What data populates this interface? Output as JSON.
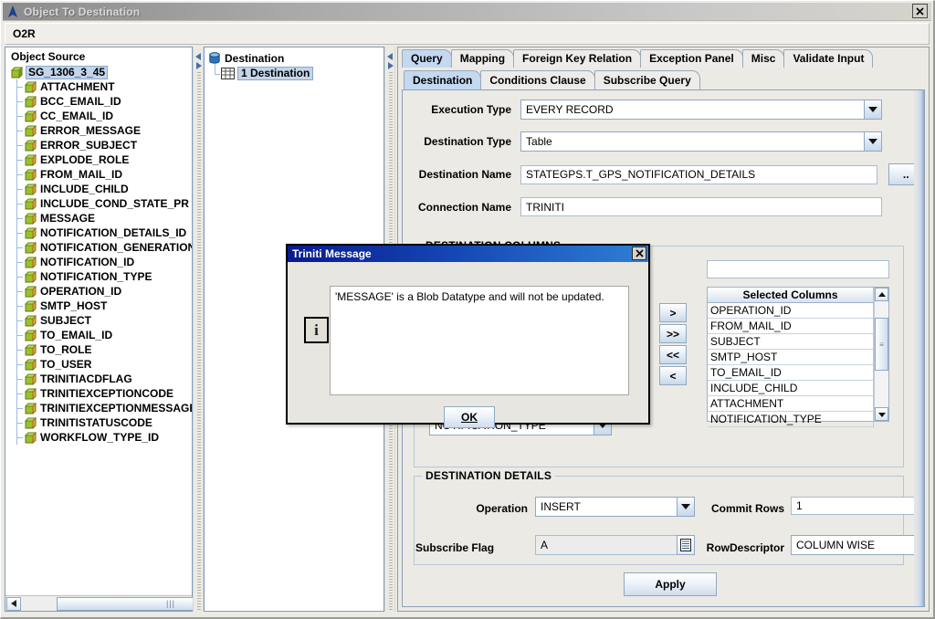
{
  "window": {
    "title": "Object To Destination",
    "close_label": "✕",
    "breadcrumb": "O2R"
  },
  "object_source": {
    "title": "Object Source",
    "root": "SG_1306_3_45",
    "items": [
      "ATTACHMENT",
      "BCC_EMAIL_ID",
      "CC_EMAIL_ID",
      "ERROR_MESSAGE",
      "ERROR_SUBJECT",
      "EXPLODE_ROLE",
      "FROM_MAIL_ID",
      "INCLUDE_CHILD",
      "INCLUDE_COND_STATE_PR",
      "MESSAGE",
      "NOTIFICATION_DETAILS_ID",
      "NOTIFICATION_GENERATION",
      "NOTIFICATION_ID",
      "NOTIFICATION_TYPE",
      "OPERATION_ID",
      "SMTP_HOST",
      "SUBJECT",
      "TO_EMAIL_ID",
      "TO_ROLE",
      "TO_USER",
      "TRINITIACDFLAG",
      "TRINITIEXCEPTIONCODE",
      "TRINITIEXCEPTIONMESSAGE",
      "TRINITISTATUSCODE",
      "WORKFLOW_TYPE_ID"
    ]
  },
  "destination_tree": {
    "root": "Destination",
    "child": "1 Destination"
  },
  "tabs_primary": [
    {
      "label": "Query",
      "active": true
    },
    {
      "label": "Mapping",
      "active": false
    },
    {
      "label": "Foreign Key Relation",
      "active": false
    },
    {
      "label": "Exception Panel",
      "active": false
    },
    {
      "label": "Misc",
      "active": false
    },
    {
      "label": "Validate Input",
      "active": false
    }
  ],
  "tabs_secondary": [
    {
      "label": "Destination",
      "active": true
    },
    {
      "label": "Conditions Clause",
      "active": false
    },
    {
      "label": "Subscribe Query",
      "active": false
    }
  ],
  "form": {
    "execution_type_label": "Execution Type",
    "execution_type_value": "EVERY RECORD",
    "destination_type_label": "Destination Type",
    "destination_type_value": "Table",
    "destination_name_label": "Destination Name",
    "destination_name_value": "STATEGPS.T_GPS_NOTIFICATION_DETAILS",
    "browse_button_label": "..",
    "connection_name_label": "Connection Name",
    "connection_name_value": "TRINITI"
  },
  "destination_columns": {
    "group_label": "DESTINATION COLUMNS",
    "filter_value": "",
    "hidden_combo_value": "NOTIFICATION_TYPE",
    "transfer_buttons": [
      ">",
      ">>",
      "<<",
      "<"
    ],
    "table_header": "Selected Columns",
    "rows": [
      "OPERATION_ID",
      "FROM_MAIL_ID",
      "SUBJECT",
      "SMTP_HOST",
      "TO_EMAIL_ID",
      "INCLUDE_CHILD",
      "ATTACHMENT",
      "NOTIFICATION_TYPE"
    ]
  },
  "destination_details": {
    "group_label": "DESTINATION DETAILS",
    "operation_label": "Operation",
    "operation_value": "INSERT",
    "commit_rows_label": "Commit Rows",
    "commit_rows_value": "1",
    "subscribe_flag_label": "Subscribe Flag",
    "subscribe_flag_value": "A",
    "row_descriptor_label": "RowDescriptor",
    "row_descriptor_value": "COLUMN WISE"
  },
  "apply_button": "Apply",
  "dialog": {
    "title": "Triniti Message",
    "close_label": "✕",
    "icon": "i",
    "message": "'MESSAGE' is a Blob Datatype and will not be updated.",
    "ok_label": "OK"
  },
  "colors": {
    "tab_active": "#c3d9f0",
    "dialog_title_start": "#0a1a8c",
    "dialog_title_end": "#2f7fd4",
    "selection": "#c3d5ea"
  }
}
